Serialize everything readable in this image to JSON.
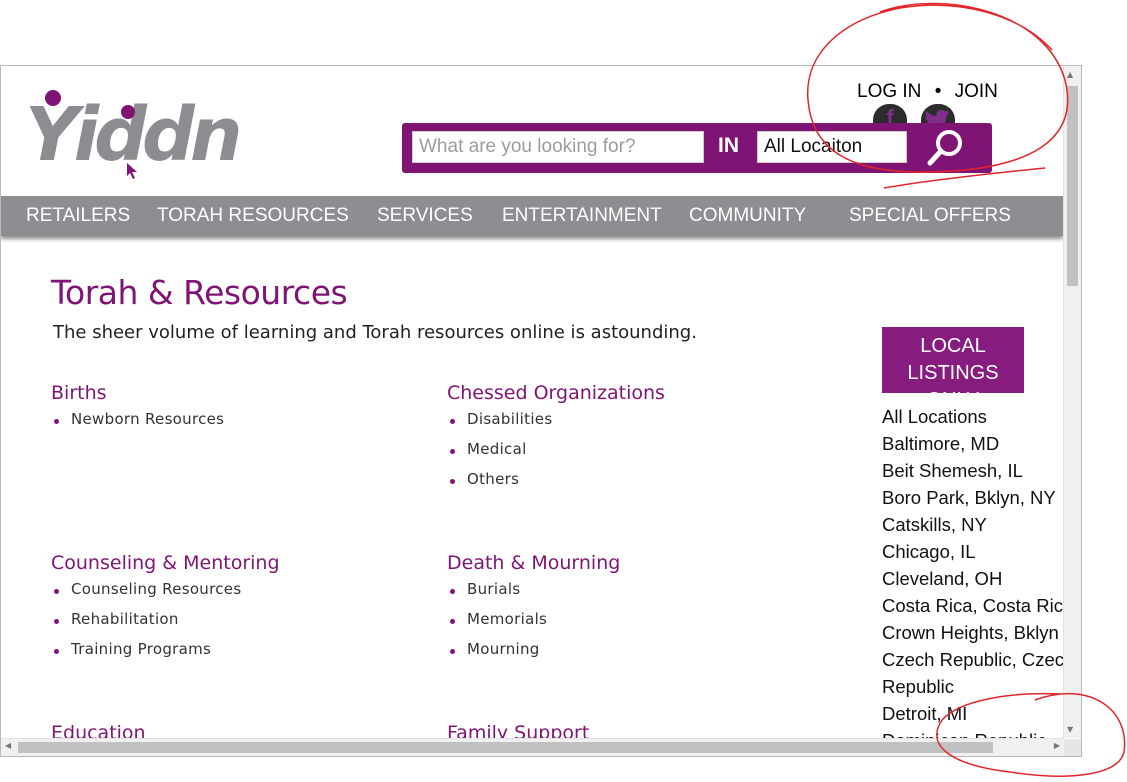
{
  "logo": {
    "text": "Yiddn"
  },
  "auth": {
    "login": "LOG IN",
    "separator": "•",
    "join": "JOIN"
  },
  "social": [
    {
      "icon": "facebook-icon",
      "glyph": "f"
    },
    {
      "icon": "twitter-icon",
      "glyph": "t"
    }
  ],
  "search": {
    "placeholder": "What are you looking for?",
    "in_label": "IN",
    "location_value": "All Locaiton"
  },
  "nav": [
    "RETAILERS",
    "TORAH RESOURCES",
    "SERVICES",
    "ENTERTAINMENT",
    "COMMUNITY",
    "SPECIAL OFFERS"
  ],
  "page": {
    "title": "Torah & Resources",
    "intro": "The sheer volume of learning and Torah resources online is astounding."
  },
  "categories": [
    {
      "title": "Births",
      "items": [
        "Newborn Resources"
      ]
    },
    {
      "title": "Chessed Organizations",
      "items": [
        "Disabilities",
        "Medical",
        "Others"
      ]
    },
    {
      "title": "Counseling & Mentoring",
      "items": [
        "Counseling Resources",
        "Rehabilitation",
        "Training Programs"
      ]
    },
    {
      "title": "Death & Mourning",
      "items": [
        "Burials",
        "Memorials",
        "Mourning"
      ]
    },
    {
      "title": "Education",
      "items": []
    },
    {
      "title": "Family Support",
      "items": []
    }
  ],
  "local_listings": {
    "button_line1": "LOCAL",
    "button_line2": "LISTINGS ONLY",
    "locations": [
      "All Locations",
      "Baltimore, MD",
      "Beit Shemesh, IL",
      "Boro Park, Bklyn, NY",
      "Catskills, NY",
      "Chicago, IL",
      "Cleveland, OH",
      "Costa Rica, Costa Rica",
      "Crown Heights, Bklyn",
      "Czech Republic, Czech",
      "Republic",
      "Detroit, MI",
      "Dominican Republic"
    ]
  },
  "colors": {
    "brand_purple": "#7f1474",
    "nav_gray": "#8e8e92",
    "annotation_red": "#e0262b"
  }
}
